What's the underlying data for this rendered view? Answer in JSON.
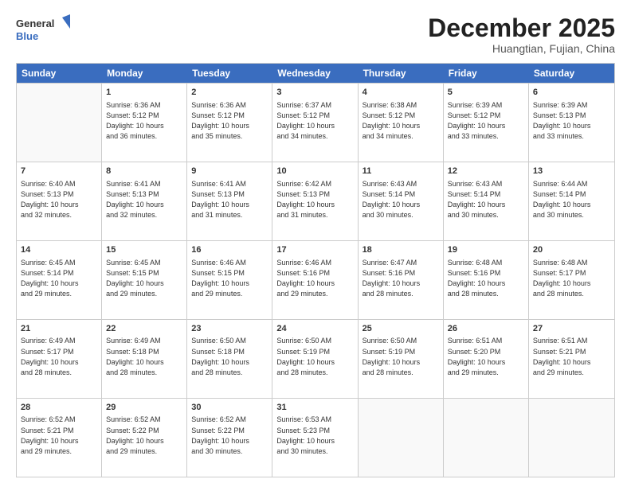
{
  "header": {
    "logo_line1": "General",
    "logo_line2": "Blue",
    "month": "December 2025",
    "location": "Huangtian, Fujian, China"
  },
  "weekdays": [
    "Sunday",
    "Monday",
    "Tuesday",
    "Wednesday",
    "Thursday",
    "Friday",
    "Saturday"
  ],
  "rows": [
    [
      {
        "day": "",
        "info": ""
      },
      {
        "day": "1",
        "info": "Sunrise: 6:36 AM\nSunset: 5:12 PM\nDaylight: 10 hours\nand 36 minutes."
      },
      {
        "day": "2",
        "info": "Sunrise: 6:36 AM\nSunset: 5:12 PM\nDaylight: 10 hours\nand 35 minutes."
      },
      {
        "day": "3",
        "info": "Sunrise: 6:37 AM\nSunset: 5:12 PM\nDaylight: 10 hours\nand 34 minutes."
      },
      {
        "day": "4",
        "info": "Sunrise: 6:38 AM\nSunset: 5:12 PM\nDaylight: 10 hours\nand 34 minutes."
      },
      {
        "day": "5",
        "info": "Sunrise: 6:39 AM\nSunset: 5:12 PM\nDaylight: 10 hours\nand 33 minutes."
      },
      {
        "day": "6",
        "info": "Sunrise: 6:39 AM\nSunset: 5:13 PM\nDaylight: 10 hours\nand 33 minutes."
      }
    ],
    [
      {
        "day": "7",
        "info": "Sunrise: 6:40 AM\nSunset: 5:13 PM\nDaylight: 10 hours\nand 32 minutes."
      },
      {
        "day": "8",
        "info": "Sunrise: 6:41 AM\nSunset: 5:13 PM\nDaylight: 10 hours\nand 32 minutes."
      },
      {
        "day": "9",
        "info": "Sunrise: 6:41 AM\nSunset: 5:13 PM\nDaylight: 10 hours\nand 31 minutes."
      },
      {
        "day": "10",
        "info": "Sunrise: 6:42 AM\nSunset: 5:13 PM\nDaylight: 10 hours\nand 31 minutes."
      },
      {
        "day": "11",
        "info": "Sunrise: 6:43 AM\nSunset: 5:14 PM\nDaylight: 10 hours\nand 30 minutes."
      },
      {
        "day": "12",
        "info": "Sunrise: 6:43 AM\nSunset: 5:14 PM\nDaylight: 10 hours\nand 30 minutes."
      },
      {
        "day": "13",
        "info": "Sunrise: 6:44 AM\nSunset: 5:14 PM\nDaylight: 10 hours\nand 30 minutes."
      }
    ],
    [
      {
        "day": "14",
        "info": "Sunrise: 6:45 AM\nSunset: 5:14 PM\nDaylight: 10 hours\nand 29 minutes."
      },
      {
        "day": "15",
        "info": "Sunrise: 6:45 AM\nSunset: 5:15 PM\nDaylight: 10 hours\nand 29 minutes."
      },
      {
        "day": "16",
        "info": "Sunrise: 6:46 AM\nSunset: 5:15 PM\nDaylight: 10 hours\nand 29 minutes."
      },
      {
        "day": "17",
        "info": "Sunrise: 6:46 AM\nSunset: 5:16 PM\nDaylight: 10 hours\nand 29 minutes."
      },
      {
        "day": "18",
        "info": "Sunrise: 6:47 AM\nSunset: 5:16 PM\nDaylight: 10 hours\nand 28 minutes."
      },
      {
        "day": "19",
        "info": "Sunrise: 6:48 AM\nSunset: 5:16 PM\nDaylight: 10 hours\nand 28 minutes."
      },
      {
        "day": "20",
        "info": "Sunrise: 6:48 AM\nSunset: 5:17 PM\nDaylight: 10 hours\nand 28 minutes."
      }
    ],
    [
      {
        "day": "21",
        "info": "Sunrise: 6:49 AM\nSunset: 5:17 PM\nDaylight: 10 hours\nand 28 minutes."
      },
      {
        "day": "22",
        "info": "Sunrise: 6:49 AM\nSunset: 5:18 PM\nDaylight: 10 hours\nand 28 minutes."
      },
      {
        "day": "23",
        "info": "Sunrise: 6:50 AM\nSunset: 5:18 PM\nDaylight: 10 hours\nand 28 minutes."
      },
      {
        "day": "24",
        "info": "Sunrise: 6:50 AM\nSunset: 5:19 PM\nDaylight: 10 hours\nand 28 minutes."
      },
      {
        "day": "25",
        "info": "Sunrise: 6:50 AM\nSunset: 5:19 PM\nDaylight: 10 hours\nand 28 minutes."
      },
      {
        "day": "26",
        "info": "Sunrise: 6:51 AM\nSunset: 5:20 PM\nDaylight: 10 hours\nand 29 minutes."
      },
      {
        "day": "27",
        "info": "Sunrise: 6:51 AM\nSunset: 5:21 PM\nDaylight: 10 hours\nand 29 minutes."
      }
    ],
    [
      {
        "day": "28",
        "info": "Sunrise: 6:52 AM\nSunset: 5:21 PM\nDaylight: 10 hours\nand 29 minutes."
      },
      {
        "day": "29",
        "info": "Sunrise: 6:52 AM\nSunset: 5:22 PM\nDaylight: 10 hours\nand 29 minutes."
      },
      {
        "day": "30",
        "info": "Sunrise: 6:52 AM\nSunset: 5:22 PM\nDaylight: 10 hours\nand 30 minutes."
      },
      {
        "day": "31",
        "info": "Sunrise: 6:53 AM\nSunset: 5:23 PM\nDaylight: 10 hours\nand 30 minutes."
      },
      {
        "day": "",
        "info": ""
      },
      {
        "day": "",
        "info": ""
      },
      {
        "day": "",
        "info": ""
      }
    ]
  ]
}
